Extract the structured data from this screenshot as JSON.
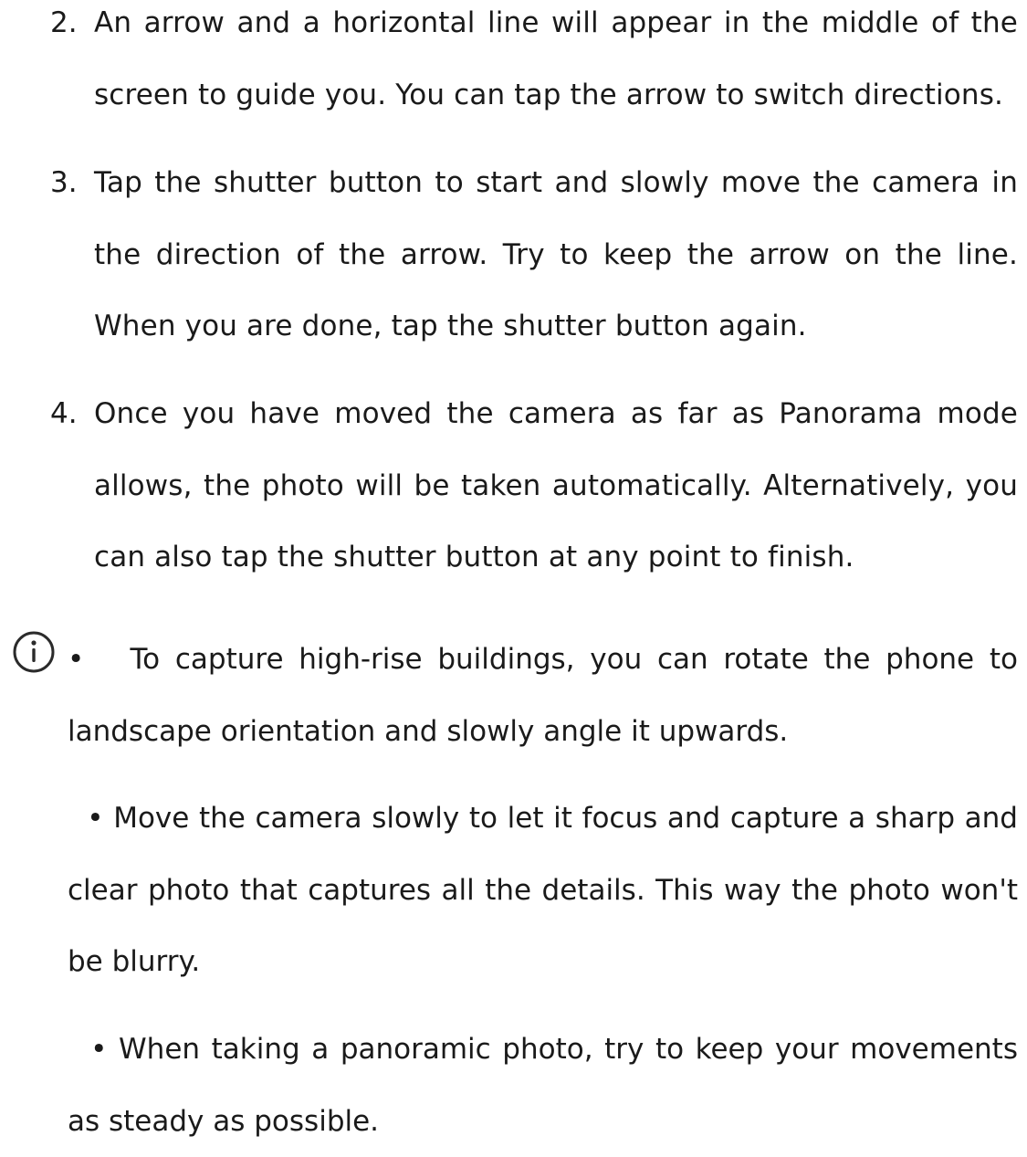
{
  "steps": [
    {
      "number": "2.",
      "text": "An arrow and a horizontal line will appear in the middle of the screen to guide you. You can tap the arrow to switch directions."
    },
    {
      "number": "3.",
      "text": "Tap the shutter button to start and slowly move the camera in the direction of the arrow. Try to keep the arrow on the line. When you are done, tap the shutter button again."
    },
    {
      "number": "4.",
      "text": "Once you have moved the camera as far as Panorama mode allows, the photo will be taken automatically. Alternatively, you can also tap the shutter button at any point to finish."
    }
  ],
  "notes": {
    "icon": "info-icon",
    "bullet": "•",
    "items": [
      "To capture high-rise buildings, you can rotate the phone to landscape orientation and slowly angle it upwards.",
      "Move the camera slowly to let it focus and capture a sharp and clear photo that captures all the details. This way the photo won't be blurry.",
      "When taking a panoramic photo, try to keep your movements as steady as possible."
    ]
  }
}
